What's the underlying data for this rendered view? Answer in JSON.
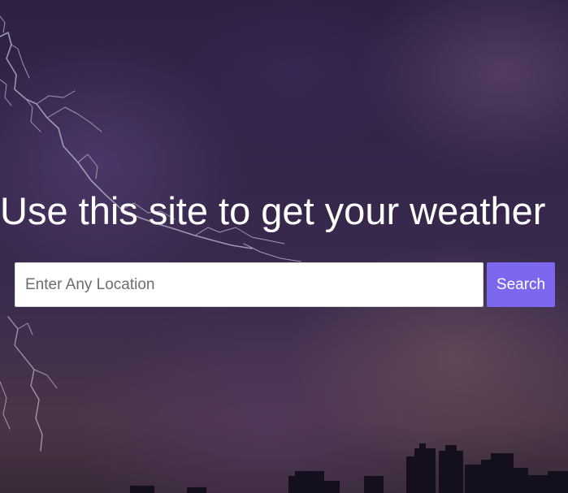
{
  "hero": {
    "title": "Use this site to get your weather"
  },
  "search": {
    "placeholder": "Enter Any Location",
    "value": "",
    "button_label": "Search"
  },
  "colors": {
    "accent": "#7b68ee",
    "background": "#2e2142",
    "text": "#ffffff"
  }
}
